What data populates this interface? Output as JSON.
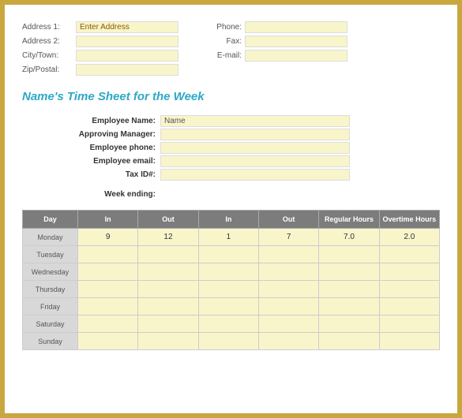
{
  "top": {
    "left": [
      {
        "label": "Address 1:",
        "value": "Enter Address"
      },
      {
        "label": "Address 2:",
        "value": ""
      },
      {
        "label": "City/Town:",
        "value": ""
      },
      {
        "label": "Zip/Postal:",
        "value": ""
      }
    ],
    "right": [
      {
        "label": "Phone:",
        "value": ""
      },
      {
        "label": "Fax:",
        "value": ""
      },
      {
        "label": "E-mail:",
        "value": ""
      }
    ]
  },
  "heading": "Name's Time Sheet for the Week",
  "employee": [
    {
      "label": "Employee Name:",
      "value": "Name"
    },
    {
      "label": "Approving Manager:",
      "value": ""
    },
    {
      "label": "Employee phone:",
      "value": ""
    },
    {
      "label": "Employee email:",
      "value": ""
    },
    {
      "label": "Tax ID#:",
      "value": ""
    }
  ],
  "week_ending_label": "Week ending:",
  "table": {
    "headers": [
      "Day",
      "In",
      "Out",
      "In",
      "Out",
      "Regular Hours",
      "Overtime Hours"
    ],
    "rows": [
      {
        "day": "Monday",
        "in1": "9",
        "out1": "12",
        "in2": "1",
        "out2": "7",
        "reg": "7.0",
        "ot": "2.0"
      },
      {
        "day": "Tuesday",
        "in1": "",
        "out1": "",
        "in2": "",
        "out2": "",
        "reg": "",
        "ot": ""
      },
      {
        "day": "Wednesday",
        "in1": "",
        "out1": "",
        "in2": "",
        "out2": "",
        "reg": "",
        "ot": ""
      },
      {
        "day": "Thursday",
        "in1": "",
        "out1": "",
        "in2": "",
        "out2": "",
        "reg": "",
        "ot": ""
      },
      {
        "day": "Friday",
        "in1": "",
        "out1": "",
        "in2": "",
        "out2": "",
        "reg": "",
        "ot": ""
      },
      {
        "day": "Saturday",
        "in1": "",
        "out1": "",
        "in2": "",
        "out2": "",
        "reg": "",
        "ot": ""
      },
      {
        "day": "Sunday",
        "in1": "",
        "out1": "",
        "in2": "",
        "out2": "",
        "reg": "",
        "ot": ""
      }
    ]
  }
}
